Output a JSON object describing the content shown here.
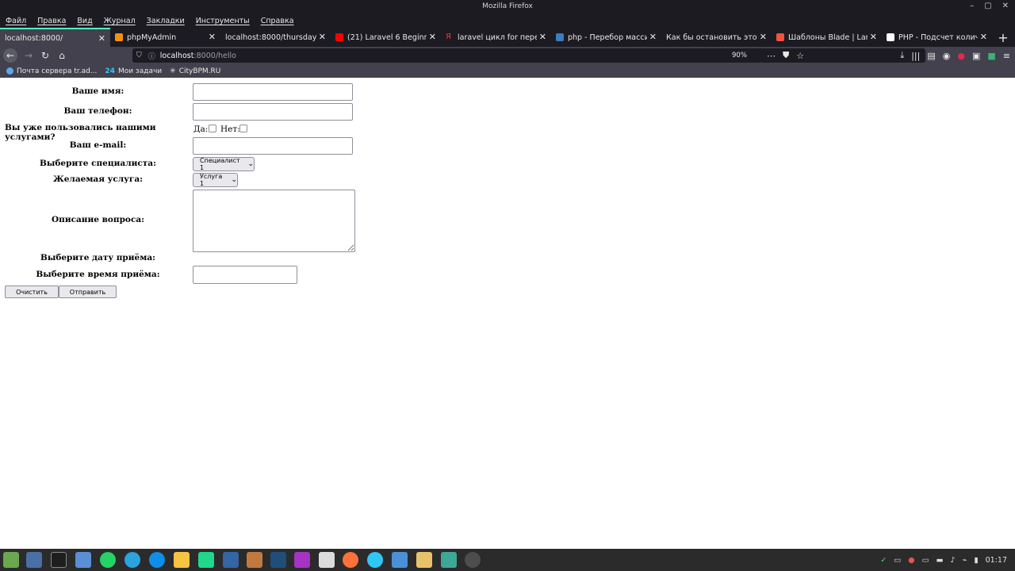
{
  "window": {
    "title": "Mozilla Firefox"
  },
  "menu": [
    "Файл",
    "Правка",
    "Вид",
    "Журнал",
    "Закладки",
    "Инструменты",
    "Справка"
  ],
  "tabs": [
    {
      "label": "localhost:8000/",
      "active": true
    },
    {
      "label": "phpMyAdmin"
    },
    {
      "label": "localhost:8000/thursday"
    },
    {
      "label": "(21) Laravel 6 Beginner -"
    },
    {
      "label": "laravel цикл for перенос"
    },
    {
      "label": "php - Перебор массива"
    },
    {
      "label": "Как бы остановить этот цик"
    },
    {
      "label": "Шаблоны Blade | Laravel"
    },
    {
      "label": "PHP - Подсчет количест"
    }
  ],
  "url": {
    "host": "localhost",
    "path": ":8000/hello",
    "zoom": "90%"
  },
  "bookmarks": [
    "Почта сервера tr.ad...",
    "Мои задачи",
    "CityBPM.RU"
  ],
  "form": {
    "name_label": "Ваше имя:",
    "phone_label": "Ваш телефон:",
    "used_label": "Вы уже пользовались нашими услугами?",
    "yes_label": "Да:",
    "no_label": "Нет:",
    "email_label": "Ваш e-mail:",
    "specialist_label": "Выберите специалиста:",
    "specialist_value": "Специалист 1",
    "service_label": "Желаемая услуга:",
    "service_value": "Услуга 1",
    "description_label": "Описание вопроса:",
    "date_label": "Выберите дату приёма:",
    "time_label": "Выберите время приёма:",
    "clear_button": "Очистить",
    "submit_button": "Отправить"
  },
  "taskbar": {
    "time": "01:17"
  },
  "colors": {
    "chrome_dark": "#1c1b22",
    "toolbar": "#42414d",
    "active_tab_accent": "#54ffbd",
    "taskbar": "#2b2b2b"
  }
}
